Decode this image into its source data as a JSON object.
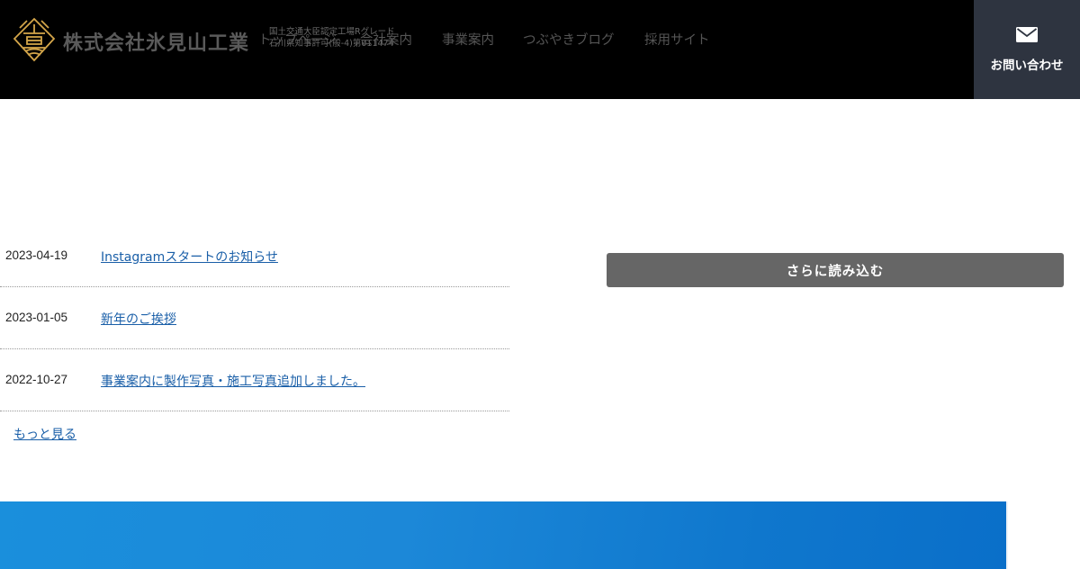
{
  "header": {
    "company_name": "株式会社氷見山工業",
    "cert_line1": "国土交通大臣認定工場Rグレード",
    "cert_line2": "石川県知事許可(般-4)第011474",
    "nav": [
      {
        "label": "トップページ"
      },
      {
        "label": "会社案内"
      },
      {
        "label": "事業案内"
      },
      {
        "label": "つぶやきブログ"
      },
      {
        "label": "採用サイト"
      }
    ],
    "contact_label": "お問い合わせ",
    "contact_icon": "mail-icon"
  },
  "news": {
    "items": [
      {
        "date": "2023-04-19",
        "title": "Instagramスタートのお知らせ"
      },
      {
        "date": "2023-01-05",
        "title": "新年のご挨拶"
      },
      {
        "date": "2022-10-27",
        "title": "事業案内に製作写真・施工写真追加しました。"
      }
    ],
    "more_label": "もっと見る"
  },
  "load_more_label": "さらに読み込む",
  "colors": {
    "header_bg": "#000000",
    "contact_bg": "#2e3440",
    "link": "#1a5fa8",
    "button_bg": "#666666",
    "banner": "#1a8fdc",
    "logo_gold": "#d4a64a"
  }
}
